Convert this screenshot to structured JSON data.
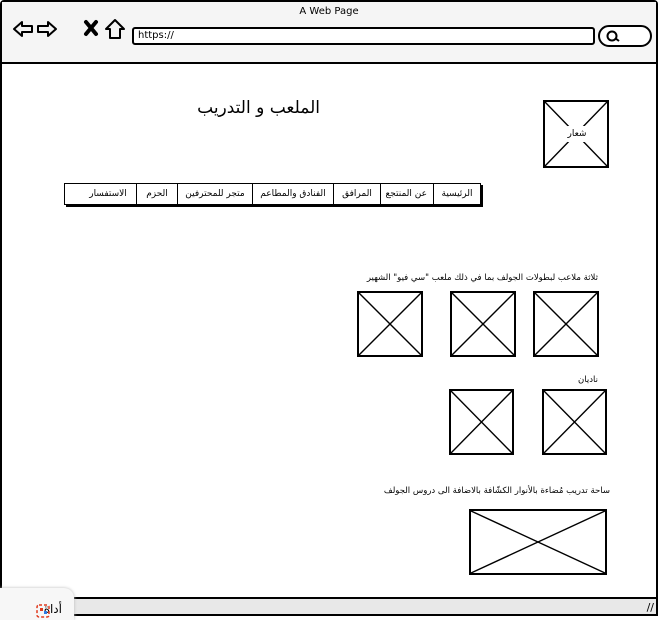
{
  "browser": {
    "window_title": "A Web Page",
    "url": "https://",
    "icons": [
      "back-arrow-icon",
      "forward-arrow-icon",
      "close-x-icon",
      "home-icon",
      "search-icon"
    ]
  },
  "page": {
    "title": "الملعب و التدريب",
    "logo_label": "شعار",
    "menu": [
      "الرئيسية",
      "عن المنتجع",
      "المرافق",
      "الفنادق والمطاعم",
      "متجر للمحترفين",
      "الحزم",
      "الاستفسار"
    ],
    "sections": {
      "courses_caption": "ثلاثة ملاعب لبطولات الجولف بما في ذلك ملعب \"سي فيو\" الشهير",
      "clubs_caption": "ناديان",
      "practice_caption": "ساحة تدريب مُضاءة بالأنوار الكشّافة بالاضافة الى  دروس الجولف"
    }
  },
  "tool_chip": {
    "label": "أداة",
    "icon": "tool-app-icon"
  }
}
